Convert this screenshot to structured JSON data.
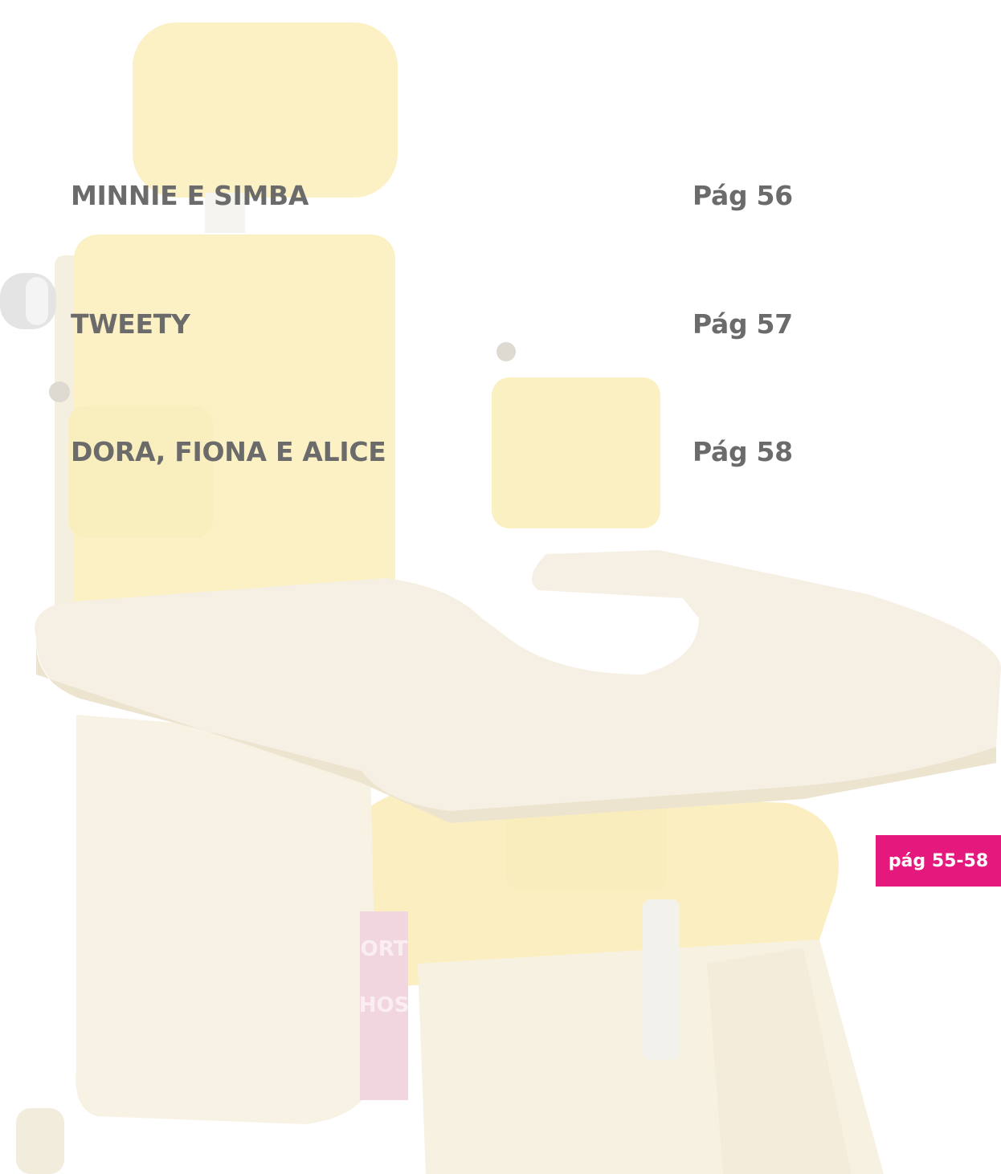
{
  "toc": {
    "entries": [
      {
        "title": "MINNIE E SIMBA",
        "page": "Pág 56"
      },
      {
        "title": "TWEETY",
        "page": "Pág 57"
      },
      {
        "title": "DORA, FIONA E ALICE",
        "page": "Pág 58"
      }
    ]
  },
  "page_tab": {
    "label": "pág 55-58",
    "color": "#e5197d"
  },
  "illustration": {
    "subject": "faded yellow postural support chair with tray",
    "logo_text": "ORTHOS"
  }
}
